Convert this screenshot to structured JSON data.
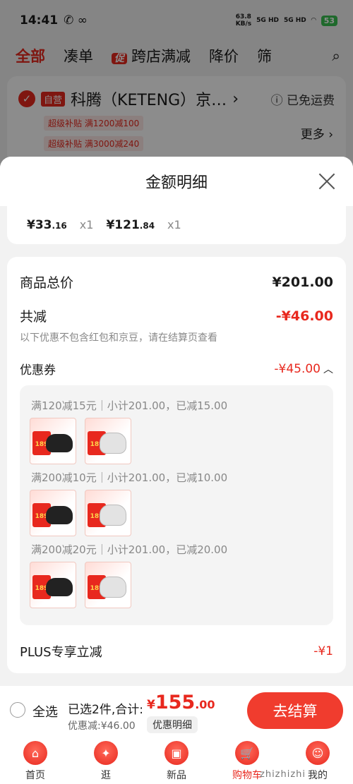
{
  "status_bar": {
    "time": "14:41",
    "net_speed": "63.8",
    "net_unit": "KB/s",
    "sig1": "5G HD",
    "sig2": "5G HD",
    "battery": "53"
  },
  "top_tabs": {
    "all": "全部",
    "bundle": "凑单",
    "promo_badge": "促",
    "cross_store": "跨店满减",
    "price_drop": "降价",
    "filter": "筛"
  },
  "shop": {
    "self_tag": "自营",
    "name": "科腾（KETENG）京…",
    "shipping": "已免运费",
    "subsidy1": "超级补贴  满1200减100",
    "subsidy2": "超级补贴  满3000减240",
    "more": "更多"
  },
  "sheet": {
    "title": "金额明细",
    "items": [
      {
        "yen": "¥",
        "int": "33",
        "dec": ".16",
        "qty": "x1"
      },
      {
        "yen": "¥",
        "int": "121",
        "dec": ".84",
        "qty": "x1"
      }
    ],
    "total_label": "商品总价",
    "total_value": "¥201.00",
    "reduce_label": "共减",
    "reduce_value": "-¥46.00",
    "reduce_note": "以下优惠不包含红包和京豆，请在结算页查看",
    "coupon_label": "优惠券",
    "coupon_value": "-¥45.00",
    "coupon_groups": [
      {
        "title": "满120减15元｜小计201.00，已减15.00"
      },
      {
        "title": "满200减10元｜小计201.00，已减10.00"
      },
      {
        "title": "满200减20元｜小计201.00，已减20.00"
      }
    ],
    "thumb_price": "189",
    "plus_label": "PLUS专享立减",
    "plus_value": "-¥1"
  },
  "checkout": {
    "select_all": "全选",
    "selected": "已选2件,合计:",
    "total_yen": "¥",
    "total_int": "155",
    "total_dec": ".00",
    "discount": "优惠减:¥46.00",
    "detail_button": "优惠明细",
    "checkout_button": "去结算"
  },
  "tabbar": [
    {
      "label": "首页"
    },
    {
      "label": "逛"
    },
    {
      "label": "新品"
    },
    {
      "label": "购物车"
    },
    {
      "label": "我的"
    }
  ],
  "watermark": "zhizhizhi"
}
